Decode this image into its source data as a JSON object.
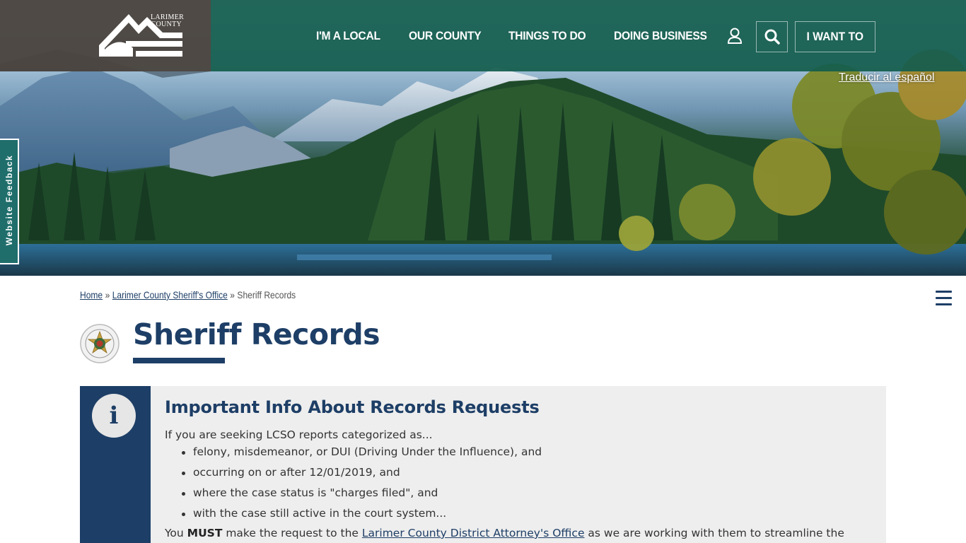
{
  "header": {
    "logo_line1": "LARIMER",
    "logo_line2": "COUNTY",
    "nav": [
      "I'M A LOCAL",
      "OUR COUNTY",
      "THINGS TO DO",
      "DOING BUSINESS"
    ],
    "i_want_to": "I WANT TO",
    "translate": "Traducir al español"
  },
  "feedback_tab": "Website Feedback",
  "breadcrumb": {
    "home": "Home",
    "separator": "»",
    "parent": "Larimer County Sheriff's Office",
    "current": "Sheriff Records"
  },
  "page_title": "Sheriff Records",
  "info_box": {
    "heading": "Important Info About Records Requests",
    "intro": "If you are seeking LCSO reports categorized as...",
    "bullets": [
      "felony, misdemeanor, or DUI (Driving Under the Influence), and",
      "occurring on or after 12/01/2019, and",
      "where the case status is \"charges filed\", and",
      "with the case still active in the court system..."
    ],
    "must_prefix": "You ",
    "must_word": "MUST",
    "must_middle": " make the request to the ",
    "must_link": "Larimer County District Attorney's Office",
    "must_suffix": " as we are working with them to streamline the"
  },
  "colors": {
    "brand_navy": "#1d3e66",
    "header_green": "#135c4e",
    "logo_box": "#4a443e",
    "info_bg": "#eeeeee"
  },
  "icons": [
    "user-icon",
    "search-icon",
    "hamburger-menu-icon",
    "info-icon",
    "sheriff-badge-icon"
  ]
}
